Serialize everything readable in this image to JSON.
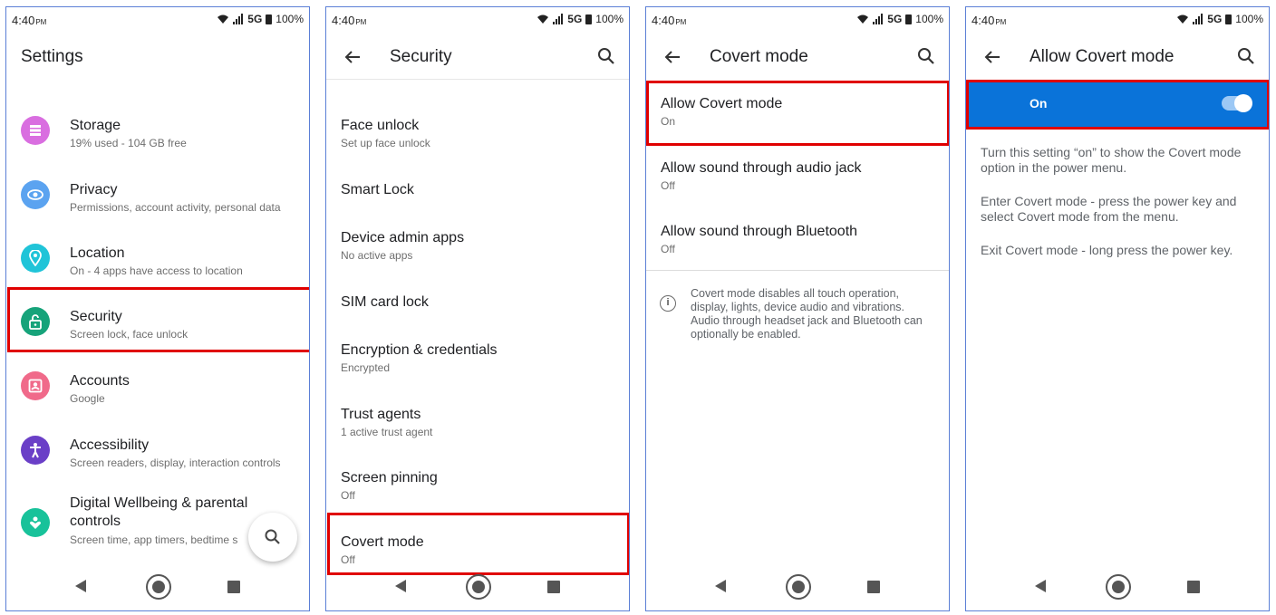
{
  "status": {
    "time": "4:40",
    "ampm": "PM",
    "network": "5G",
    "battery": "100%"
  },
  "panel1": {
    "title": "Settings",
    "items": [
      {
        "title": "Storage",
        "subtitle": "19% used - 104 GB free",
        "icon": "storage-icon",
        "color": "#d96ee0"
      },
      {
        "title": "Privacy",
        "subtitle": "Permissions, account activity, personal data",
        "icon": "privacy-icon",
        "color": "#5ba3f0"
      },
      {
        "title": "Location",
        "subtitle": "On - 4 apps have access to location",
        "icon": "location-icon",
        "color": "#20c4d8"
      },
      {
        "title": "Security",
        "subtitle": "Screen lock, face unlock",
        "icon": "security-lock-icon",
        "color": "#16a37a"
      },
      {
        "title": "Accounts",
        "subtitle": "Google",
        "icon": "accounts-icon",
        "color": "#f06a8a"
      },
      {
        "title": "Accessibility",
        "subtitle": "Screen readers, display, interaction controls",
        "icon": "accessibility-icon",
        "color": "#6a3fc7"
      },
      {
        "title": "Digital Wellbeing & parental",
        "title2": "controls",
        "subtitle": "Screen time, app timers, bedtime s",
        "icon": "wellbeing-icon",
        "color": "#18c29a"
      }
    ]
  },
  "panel2": {
    "title": "Security",
    "items": [
      {
        "title": "Face unlock",
        "subtitle": "Set up face unlock"
      },
      {
        "title": "Smart Lock",
        "subtitle": ""
      },
      {
        "title": "Device admin apps",
        "subtitle": "No active apps"
      },
      {
        "title": "SIM card lock",
        "subtitle": ""
      },
      {
        "title": "Encryption & credentials",
        "subtitle": "Encrypted"
      },
      {
        "title": "Trust agents",
        "subtitle": "1 active trust agent"
      },
      {
        "title": "Screen pinning",
        "subtitle": "Off"
      },
      {
        "title": "Covert mode",
        "subtitle": "Off"
      }
    ]
  },
  "panel3": {
    "title": "Covert mode",
    "items": [
      {
        "title": "Allow Covert mode",
        "subtitle": "On"
      },
      {
        "title": "Allow sound through audio jack",
        "subtitle": "Off"
      },
      {
        "title": "Allow sound through Bluetooth",
        "subtitle": "Off"
      }
    ],
    "info": "Covert mode disables all touch operation, display, lights, device audio and vibrations. Audio through headset jack and Bluetooth can optionally be enabled."
  },
  "panel4": {
    "title": "Allow Covert mode",
    "switch_label": "On",
    "switch_on": true,
    "paragraphs": [
      "Turn this setting “on” to show the Covert mode option in the power menu.",
      "Enter Covert mode - press the power key and select Covert mode from the menu.",
      "Exit Covert mode - long press the power key."
    ]
  },
  "colors": {
    "highlight": "#e00000",
    "accent": "#0a73d9",
    "frame": "#5b7fd6"
  }
}
